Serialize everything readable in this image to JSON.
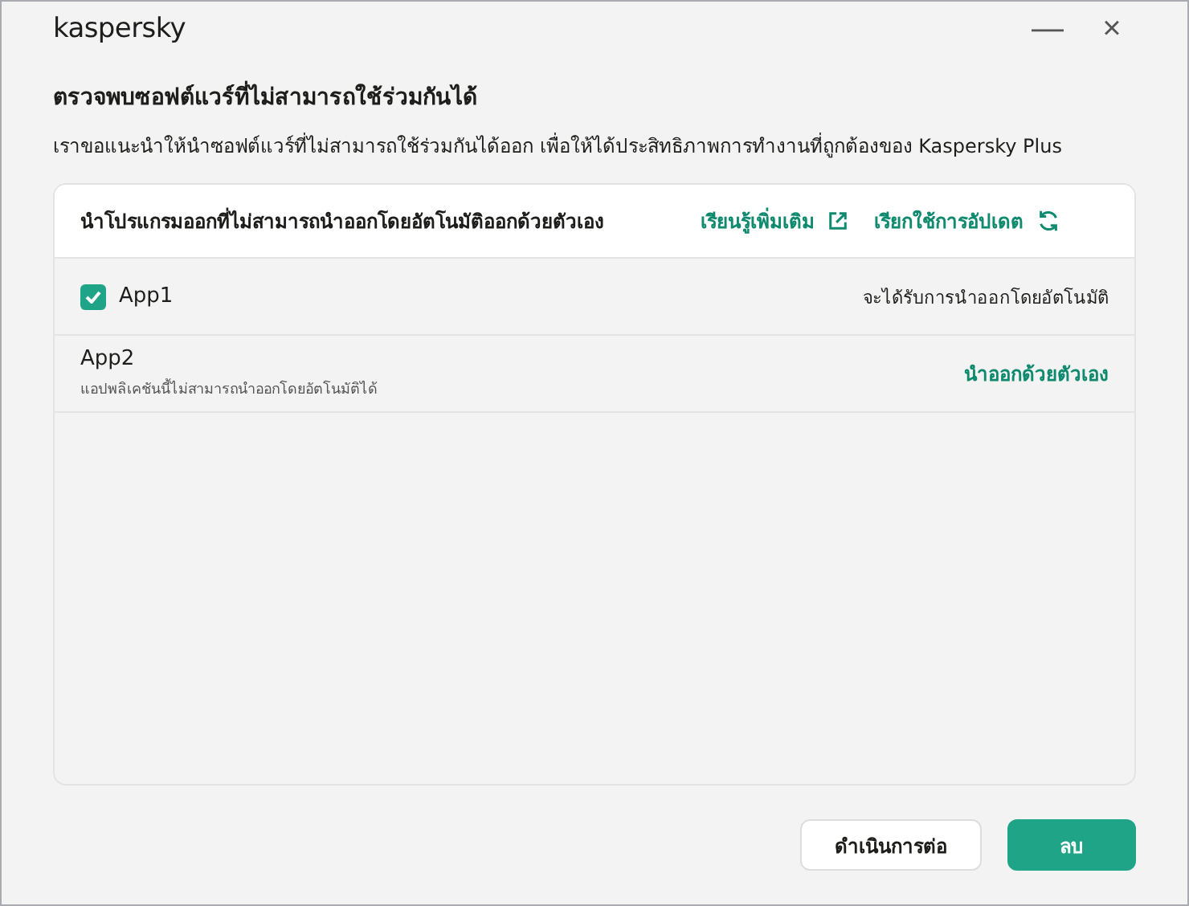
{
  "window": {
    "logo": "kaspersky",
    "minimize": "—",
    "close": "×"
  },
  "title": "ตรวจพบซอฟต์แวร์ที่ไม่สามารถใช้ร่วมกันได้",
  "description": "เราขอแนะนำให้นำซอฟต์แวร์ที่ไม่สามารถใช้ร่วมกันได้ออก เพื่อให้ได้ประสิทธิภาพการทำงานที่ถูกต้องของ Kaspersky Plus",
  "panel": {
    "heading": "นำโปรแกรมออกที่ไม่สามารถนำออกโดยอัตโนมัติออกด้วยตัวเอง",
    "links": [
      {
        "label": "เรียนรู้เพิ่มเติม",
        "kind": "external"
      },
      {
        "label": "เรียกใช้การอัปเดต",
        "kind": "refresh"
      }
    ]
  },
  "apps": [
    {
      "kind": "auto",
      "name": "App1",
      "checked": true,
      "status": "จะได้รับการนำออกโดยอัตโนมัติ"
    },
    {
      "kind": "manual",
      "name": "App2",
      "note": "แอปพลิเคชันนี้ไม่สามารถนำออกโดยอัตโนมัติได้",
      "action": "นำออกด้วยตัวเอง"
    }
  ],
  "buttons": [
    {
      "label": "ดำเนินการต่อ",
      "kind": "secondary"
    },
    {
      "label": "ลบ",
      "kind": "primary"
    }
  ]
}
